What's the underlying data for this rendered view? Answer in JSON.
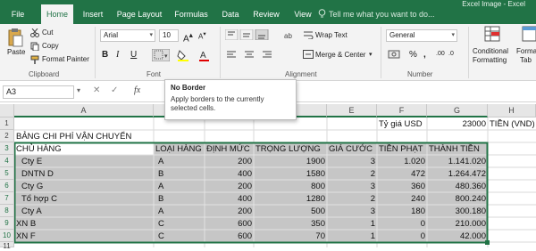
{
  "titlebar": {
    "tabs": [
      "File",
      "Home",
      "Insert",
      "Page Layout",
      "Formulas",
      "Data",
      "Review",
      "View"
    ],
    "active_tab": "Home",
    "tell_me": "Tell me what you want to do...",
    "right_text": "Excel Image - Excel"
  },
  "ribbon": {
    "clipboard": {
      "paste": "Paste",
      "cut": "Cut",
      "copy": "Copy",
      "format_painter": "Format Painter",
      "group": "Clipboard"
    },
    "font": {
      "name": "Arial",
      "size": "10",
      "bold": "B",
      "italic": "I",
      "underline": "U",
      "group": "Font"
    },
    "alignment": {
      "wrap": "Wrap Text",
      "merge": "Merge & Center",
      "group": "Alignment"
    },
    "number": {
      "format": "General",
      "percent": "%",
      "comma": ",",
      "group": "Number"
    },
    "styles": {
      "conditional": "Conditional",
      "conditional2": "Formatting",
      "format_as": "Forma",
      "format_as2": "Tab"
    }
  },
  "formula_bar": {
    "name_box": "A3",
    "fx": "fx"
  },
  "tooltip": {
    "title": "No Border",
    "desc": "Apply borders to the currently selected cells."
  },
  "columns": [
    "A",
    "B",
    "C",
    "D",
    "E",
    "F",
    "G",
    "H"
  ],
  "rows": [
    "1",
    "2",
    "3",
    "4",
    "5",
    "6",
    "7",
    "8",
    "9",
    "10",
    "11"
  ],
  "cells": {
    "r1": {
      "f": "Tỷ giá USD",
      "g": "23000",
      "h": "TIỀN (VND)"
    },
    "r2": {
      "a": "BẢNG CHI PHÍ VẬN CHUYỂN"
    },
    "header": [
      "CHỦ HÀNG",
      "LOẠI HÀNG",
      "ĐỊNH MỨC",
      "TRỌNG LƯỢNG",
      "GIÁ CƯỚC",
      "TIỀN PHẠT",
      "THÀNH TIỀN"
    ],
    "data": [
      [
        "Cty E",
        "A",
        "200",
        "1900",
        "3",
        "1.020",
        "1.141.020"
      ],
      [
        "DNTN D",
        "B",
        "400",
        "1580",
        "2",
        "472",
        "1.264.472"
      ],
      [
        "Cty G",
        "A",
        "200",
        "800",
        "3",
        "360",
        "480.360"
      ],
      [
        "Tổ hợp C",
        "B",
        "400",
        "1280",
        "2",
        "240",
        "800.240"
      ],
      [
        "Cty A",
        "A",
        "200",
        "500",
        "3",
        "180",
        "300.180"
      ],
      [
        "XN B",
        "C",
        "600",
        "350",
        "1",
        "0",
        "210.000"
      ],
      [
        "XN F",
        "C",
        "600",
        "70",
        "1",
        "0",
        "42.000"
      ]
    ]
  },
  "colors": {
    "accent": "#217346",
    "selection": "#c6c6c6"
  }
}
